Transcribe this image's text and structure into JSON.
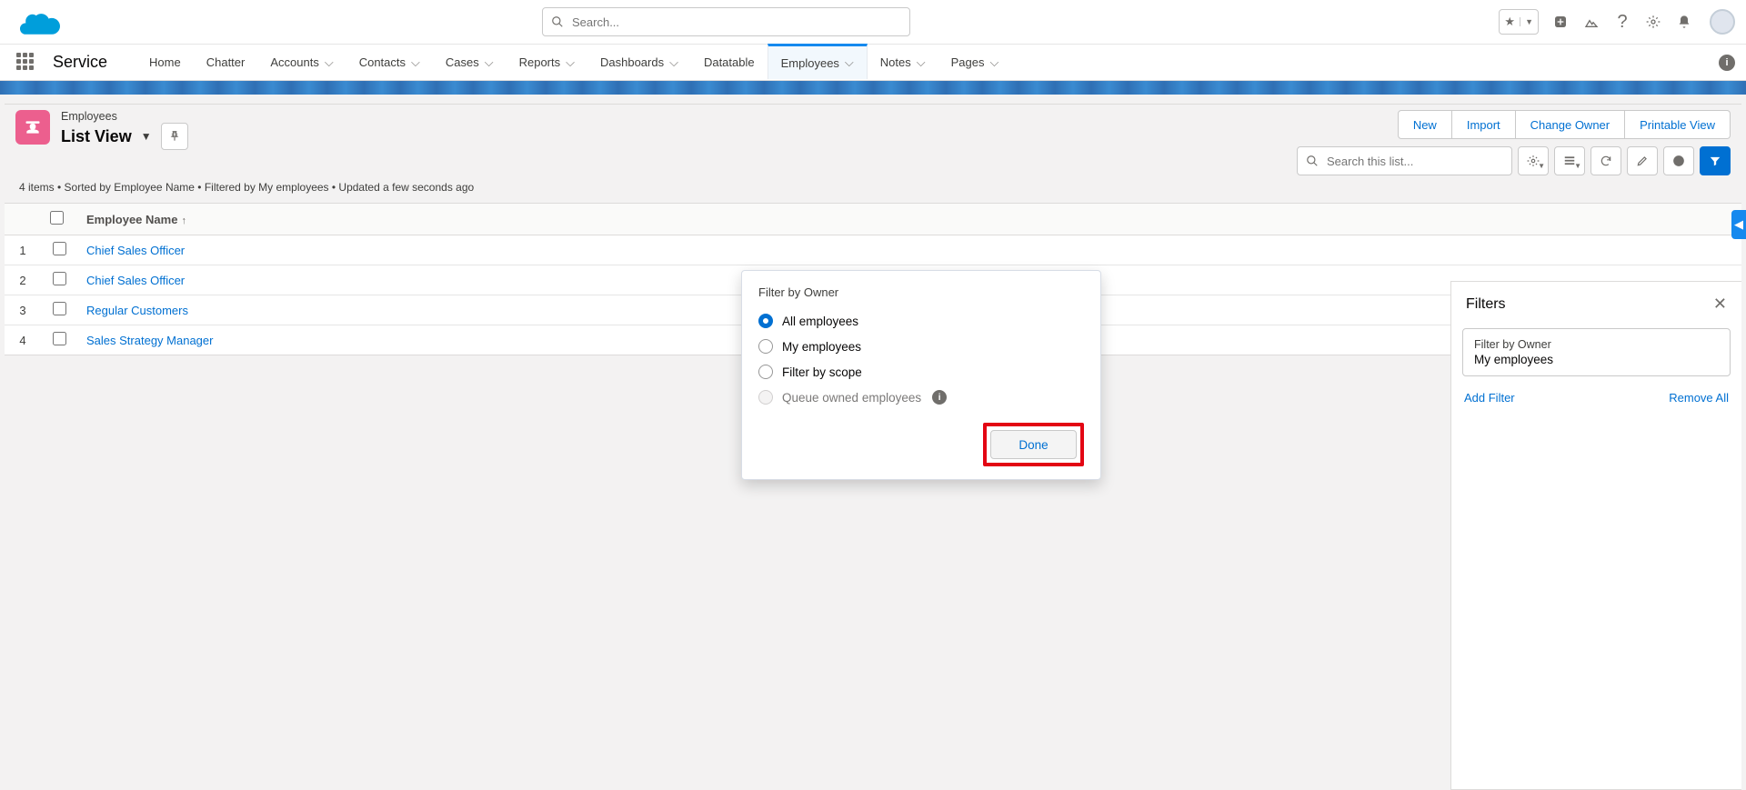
{
  "header": {
    "search_placeholder": "Search..."
  },
  "nav": {
    "app_name": "Service",
    "tabs": [
      {
        "label": "Home",
        "chev": false
      },
      {
        "label": "Chatter",
        "chev": false
      },
      {
        "label": "Accounts",
        "chev": true
      },
      {
        "label": "Contacts",
        "chev": true
      },
      {
        "label": "Cases",
        "chev": true
      },
      {
        "label": "Reports",
        "chev": true
      },
      {
        "label": "Dashboards",
        "chev": true
      },
      {
        "label": "Datatable",
        "chev": false
      },
      {
        "label": "Employees",
        "chev": true,
        "active": true
      },
      {
        "label": "Notes",
        "chev": true
      },
      {
        "label": "Pages",
        "chev": true
      }
    ]
  },
  "list_header": {
    "object_label": "Employees",
    "view_title": "List View",
    "info_line": "4 items • Sorted by Employee Name • Filtered by My employees • Updated a few seconds ago",
    "actions": {
      "new": "New",
      "import": "Import",
      "change_owner": "Change Owner",
      "printable": "Printable View"
    },
    "search_placeholder": "Search this list..."
  },
  "table": {
    "column": "Employee Name",
    "rows": [
      {
        "n": "1",
        "name": "Chief Sales Officer"
      },
      {
        "n": "2",
        "name": "Chief Sales Officer"
      },
      {
        "n": "3",
        "name": "Regular Customers"
      },
      {
        "n": "4",
        "name": "Sales Strategy Manager"
      }
    ]
  },
  "popover": {
    "title": "Filter by Owner",
    "opts": {
      "all": "All employees",
      "my": "My employees",
      "scope": "Filter by scope",
      "queue": "Queue owned employees"
    },
    "done": "Done"
  },
  "filters_panel": {
    "title": "Filters",
    "card": {
      "label": "Filter by Owner",
      "value": "My employees"
    },
    "add": "Add Filter",
    "remove": "Remove All"
  }
}
